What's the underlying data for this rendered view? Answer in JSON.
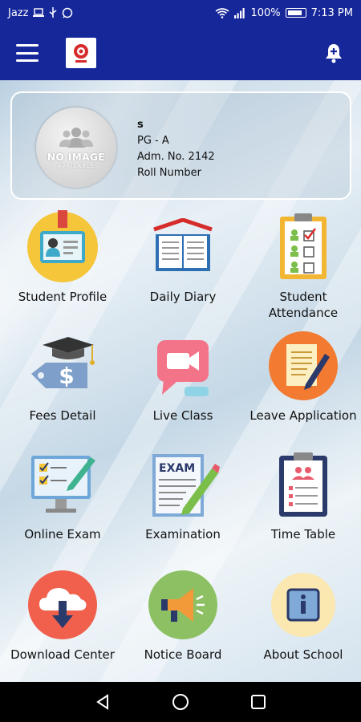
{
  "status_bar": {
    "carrier": "Jazz",
    "battery_percent": "100%",
    "time": "7:13 PM"
  },
  "app_bar": {
    "logo_icon": "school-logo-icon",
    "menu_icon": "hamburger-menu-icon",
    "notification_icon": "bell-icon"
  },
  "profile": {
    "avatar_text": "NO IMAGE",
    "avatar_subtext": "AVAILABLE",
    "name": "s",
    "class_section": "PG - A",
    "adm_no": "Adm. No.  2142",
    "roll_number": "Roll Number"
  },
  "menu": [
    {
      "label": "Student Profile",
      "icon": "id-card-icon"
    },
    {
      "label": "Daily Diary",
      "icon": "open-book-icon"
    },
    {
      "label": "Student\nAttendance",
      "icon": "attendance-clipboard-icon"
    },
    {
      "label": "Fees Detail",
      "icon": "fees-tag-icon"
    },
    {
      "label": "Live Class",
      "icon": "video-camera-icon"
    },
    {
      "label": "Leave Application",
      "icon": "pen-notepad-icon"
    },
    {
      "label": "Online Exam",
      "icon": "monitor-checklist-icon"
    },
    {
      "label": "Examination",
      "icon": "exam-paper-icon"
    },
    {
      "label": "Time Table",
      "icon": "timetable-clipboard-icon"
    },
    {
      "label": "Download Center",
      "icon": "cloud-download-icon"
    },
    {
      "label": "Notice Board",
      "icon": "megaphone-icon"
    },
    {
      "label": "About School",
      "icon": "info-icon"
    }
  ],
  "colors": {
    "primary": "#16279a",
    "nav_bar": "#000000"
  }
}
